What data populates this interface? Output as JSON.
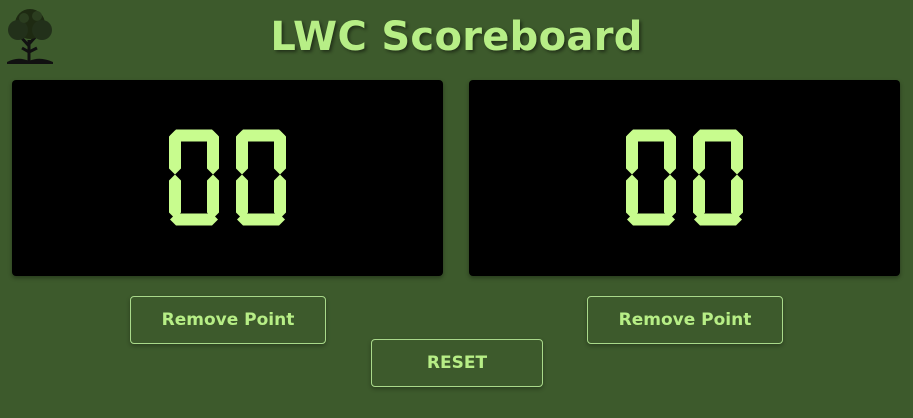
{
  "header": {
    "title": "LWC Scoreboard",
    "logo_icon": "tree-book-icon"
  },
  "scoreboards": [
    {
      "score": "00"
    },
    {
      "score": "00"
    }
  ],
  "controls": {
    "remove_point_left_label": "Remove Point",
    "remove_point_right_label": "Remove Point",
    "reset_label": "RESET"
  },
  "colors": {
    "background": "#3d5a2c",
    "accent": "#b7ee86",
    "segment_on": "#c8fc8e",
    "board": "#000000"
  }
}
